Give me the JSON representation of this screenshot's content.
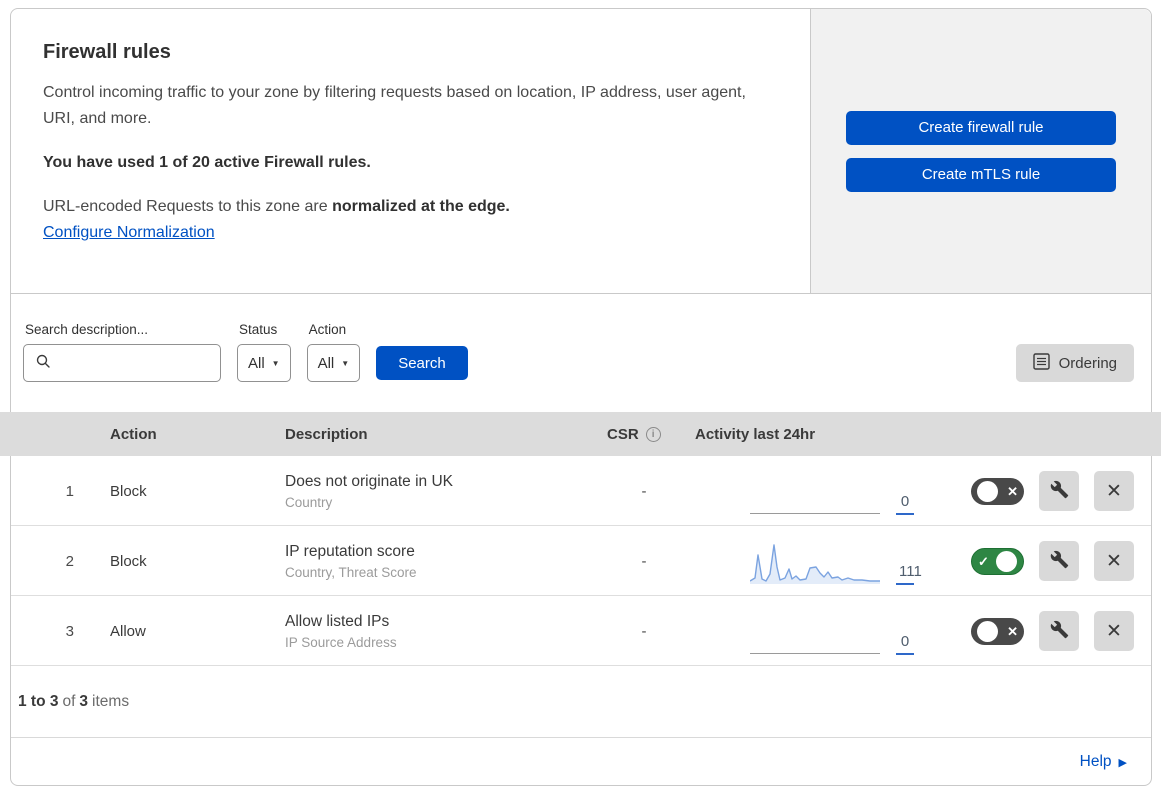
{
  "header": {
    "title": "Firewall rules",
    "description": "Control incoming traffic to your zone by filtering requests based on location, IP address, user agent, URI, and more.",
    "usage": "You have used 1 of 20 active Firewall rules.",
    "normalization_prefix": "URL-encoded Requests to this zone are ",
    "normalization_bold": "normalized at the edge.",
    "normalization_link": "Configure Normalization",
    "create_firewall_rule_label": "Create firewall rule",
    "create_mtls_rule_label": "Create mTLS rule"
  },
  "filters": {
    "search_label": "Search description...",
    "status_label": "Status",
    "status_value": "All",
    "action_label": "Action",
    "action_value": "All",
    "search_button_label": "Search",
    "ordering_button_label": "Ordering"
  },
  "table": {
    "columns": {
      "action": "Action",
      "description": "Description",
      "csr": "CSR",
      "activity": "Activity last 24hr"
    },
    "rows": [
      {
        "priority": "1",
        "action": "Block",
        "description": "Does not originate in UK",
        "fields": "Country",
        "csr": "-",
        "activity_count": "0",
        "enabled": false,
        "sparkline": "flat"
      },
      {
        "priority": "2",
        "action": "Block",
        "description": "IP reputation score",
        "fields": "Country, Threat Score",
        "csr": "-",
        "activity_count": "111",
        "enabled": true,
        "sparkline": {
          "points": [
            [
              0,
              40
            ],
            [
              5,
              37
            ],
            [
              8,
              14
            ],
            [
              12,
              38
            ],
            [
              16,
              40
            ],
            [
              20,
              33
            ],
            [
              24,
              4
            ],
            [
              27,
              26
            ],
            [
              30,
              39
            ],
            [
              35,
              37
            ],
            [
              39,
              28
            ],
            [
              42,
              38
            ],
            [
              46,
              35
            ],
            [
              50,
              39
            ],
            [
              56,
              38
            ],
            [
              60,
              27
            ],
            [
              66,
              26
            ],
            [
              70,
              32
            ],
            [
              74,
              36
            ],
            [
              78,
              31
            ],
            [
              82,
              37
            ],
            [
              88,
              36
            ],
            [
              92,
              39
            ],
            [
              98,
              37
            ],
            [
              104,
              39
            ],
            [
              112,
              39
            ],
            [
              120,
              40
            ],
            [
              130,
              40
            ]
          ]
        }
      },
      {
        "priority": "3",
        "action": "Allow",
        "description": "Allow listed IPs",
        "fields": "IP Source Address",
        "csr": "-",
        "activity_count": "0",
        "enabled": false,
        "sparkline": "flat"
      }
    ]
  },
  "footer": {
    "range": "1 to 3",
    "of": "of",
    "total": "3",
    "items": "items",
    "help_label": "Help"
  },
  "colors": {
    "accent_blue": "#0051c3",
    "panel_gray": "#f1f1f1",
    "table_header_gray": "#dcdcdc",
    "button_gray": "#d9d9d9",
    "toggle_on_green": "#2e8644",
    "toggle_off_gray": "#494949",
    "sparkline_blue": "#7ba3e0",
    "sparkline_fill": "#dce7f7"
  }
}
